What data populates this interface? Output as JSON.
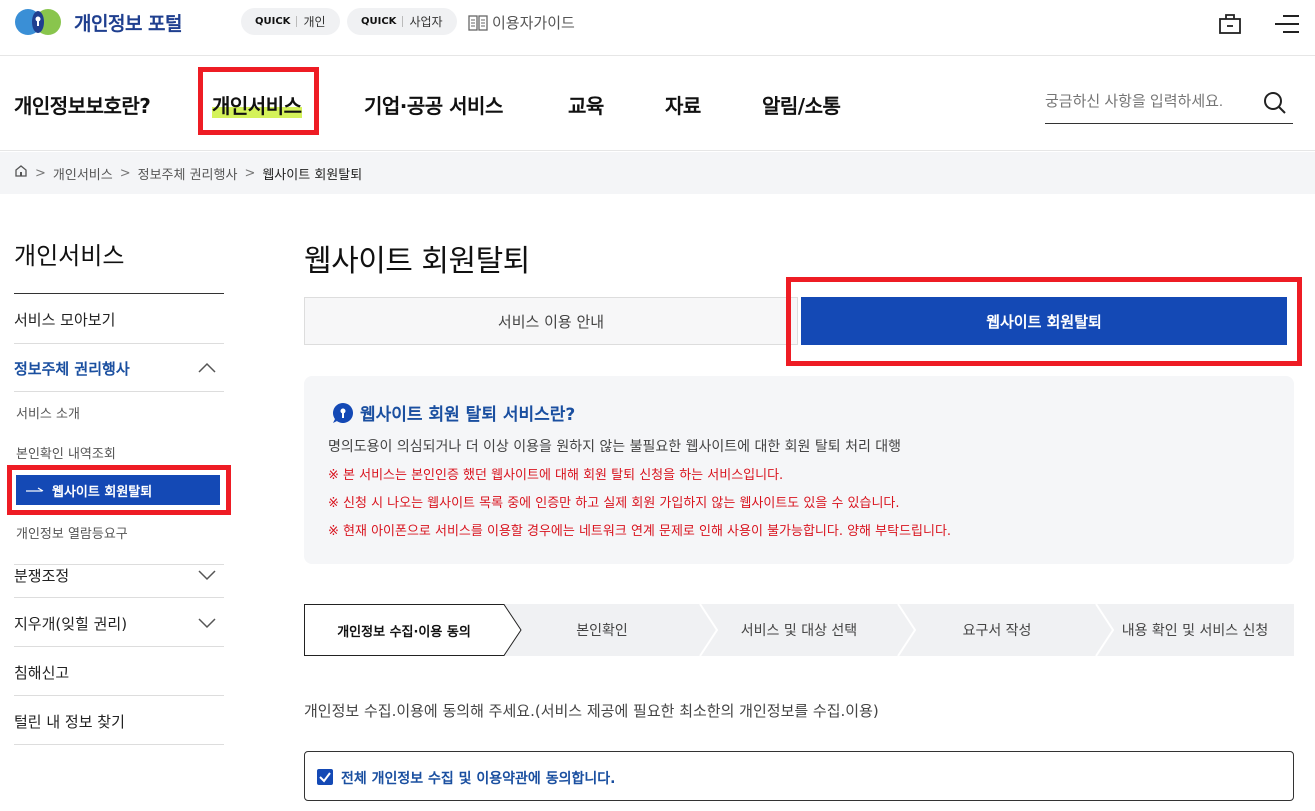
{
  "header": {
    "logo_text": "개인정보 포털",
    "quick_links": [
      {
        "tag": "QUICK",
        "label": "개인"
      },
      {
        "tag": "QUICK",
        "label": "사업자"
      }
    ],
    "guide_label": "이용자가이드",
    "icons": [
      "briefcase-icon",
      "menu-icon"
    ]
  },
  "gnb": {
    "items": [
      "개인정보보호란?",
      "개인서비스",
      "기업·공공 서비스",
      "교육",
      "자료",
      "알림/소통"
    ],
    "active_index": 1,
    "search_placeholder": "궁금하신 사항을 입력하세요."
  },
  "breadcrumb": {
    "items": [
      "개인서비스",
      "정보주체 권리행사",
      "웹사이트 회원탈퇴"
    ]
  },
  "sidebar": {
    "title": "개인서비스",
    "items": [
      {
        "label": "서비스 모아보기"
      },
      {
        "label": "정보주체 권리행사",
        "expanded": true
      },
      {
        "label": "분쟁조정",
        "expanded": false
      },
      {
        "label": "지우개(잊힐 권리)",
        "expanded": false
      },
      {
        "label": "침해신고"
      },
      {
        "label": "털린 내 정보 찾기"
      }
    ],
    "subitems": [
      "서비스 소개",
      "본인확인 내역조회",
      "웹사이트 회원탈퇴",
      "개인정보 열람등요구"
    ],
    "active_subitem": "웹사이트 회원탈퇴"
  },
  "main": {
    "title": "웹사이트 회원탈퇴",
    "tabs": [
      "서비스 이용 안내",
      "웹사이트 회원탈퇴"
    ],
    "active_tab": 1,
    "info": {
      "heading": "웹사이트 회원 탈퇴 서비스란?",
      "description": "명의도용이 의심되거나 더 이상 이용을 원하지 않는 불필요한 웹사이트에 대한 회원 탈퇴 처리 대행",
      "notes": [
        "※ 본 서비스는 본인인증 했던 웹사이트에 대해 회원 탈퇴 신청을 하는 서비스입니다.",
        "※ 신청 시 나오는 웹사이트 목록 중에 인증만 하고 실제 회원 가입하지 않는 웹사이트도 있을 수 있습니다.",
        "※ 현재 아이폰으로 서비스를 이용할 경우에는 네트워크 연계 문제로 인해 사용이 불가능합니다. 양해 부탁드립니다."
      ]
    },
    "steps": [
      "개인정보 수집·이용 동의",
      "본인확인",
      "서비스 및 대상 선택",
      "요구서 작성",
      "내용 확인 및 서비스 신청"
    ],
    "active_step": 0,
    "consent_text": "개인정보 수집.이용에 동의해 주세요.(서비스 제공에 필요한 최소한의 개인정보를 수집.이용)",
    "agree_all_label": "전체 개인정보 수집 및 이용약관에 동의합니다.",
    "agree_all_checked": true
  },
  "colors": {
    "primary": "#1449b5",
    "highlight": "#d4f25a",
    "annotation_red": "#ee1c24",
    "note_red": "#d9141f"
  }
}
